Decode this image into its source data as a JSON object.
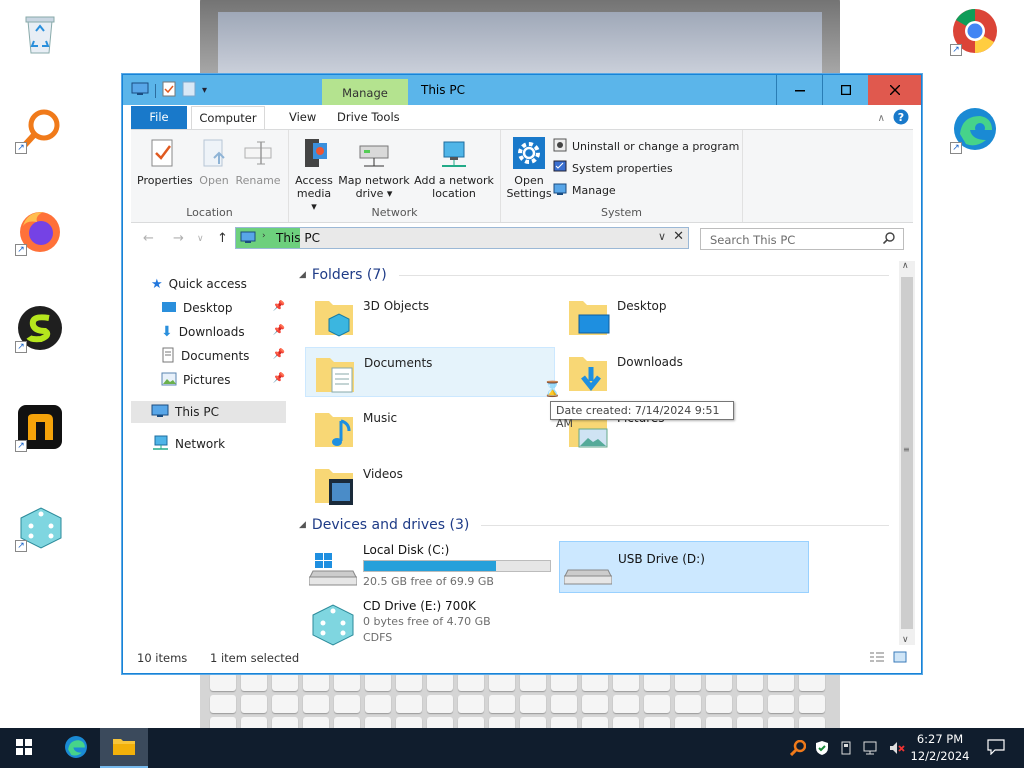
{
  "window": {
    "title": "This PC",
    "manage_tab": "Manage",
    "tabs": {
      "file": "File",
      "computer": "Computer",
      "view": "View",
      "drive_tools": "Drive Tools"
    }
  },
  "ribbon": {
    "location": {
      "label": "Location",
      "properties": "Properties",
      "open": "Open",
      "rename": "Rename"
    },
    "network": {
      "label": "Network",
      "access_media": [
        "Access",
        "media ▾"
      ],
      "map_drive": [
        "Map network",
        "drive ▾"
      ],
      "add_location": [
        "Add a network",
        "location"
      ]
    },
    "system": {
      "label": "System",
      "open_settings": [
        "Open",
        "Settings"
      ],
      "uninstall": "Uninstall or change a program",
      "system_properties": "System properties",
      "manage": "Manage"
    }
  },
  "address": {
    "path": "This PC",
    "search_placeholder": "Search This PC"
  },
  "nav_pane": {
    "quick_access": "Quick access",
    "pinned": [
      "Desktop",
      "Downloads",
      "Documents",
      "Pictures"
    ],
    "this_pc": "This PC",
    "network": "Network"
  },
  "folders": {
    "header": "Folders (7)",
    "items": [
      "3D Objects",
      "Desktop",
      "Documents",
      "Downloads",
      "Music",
      "Pictures",
      "Videos"
    ]
  },
  "drives": {
    "header": "Devices and drives (3)",
    "local": {
      "name": "Local Disk (C:)",
      "free": "20.5 GB free of 69.9 GB",
      "used_fraction": 0.707
    },
    "usb": {
      "name": "USB Drive (D:)"
    },
    "cd": {
      "name": "CD Drive (E:) 700K",
      "free": "0 bytes free of 4.70 GB",
      "fs": "CDFS"
    }
  },
  "tooltip": "Date created: 7/14/2024 9:51 AM",
  "status": {
    "items": "10 items",
    "selected": "1 item selected"
  },
  "taskbar": {
    "time": "6:27 PM",
    "date": "12/2/2024"
  },
  "colors": {
    "accent": "#1979ca",
    "titlebar": "#5bb5ea",
    "manage": "#b4e38f",
    "close": "#e0594e",
    "taskbar": "#101d2d",
    "bar_fill": "#26a0da"
  }
}
